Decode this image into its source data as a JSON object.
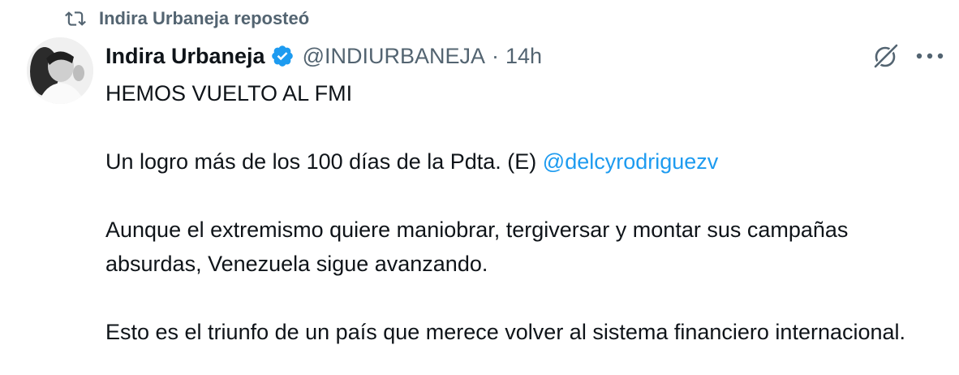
{
  "repost": {
    "icon": "repost-icon",
    "text": "Indira Urbaneja reposteó"
  },
  "author": {
    "name": "Indira Urbaneja",
    "handle": "@INDIURBANEJA",
    "separator": "·",
    "time": "14h",
    "verified_color": "#1d9bf0"
  },
  "actions": {
    "grok_icon": "grok-icon",
    "more_icon": "more-icon"
  },
  "tweet": {
    "line1": "HEMOS VUELTO AL FMI",
    "line2_text": "Un logro más de los 100 días de la Pdta. (E) ",
    "line2_mention": "@delcyrodriguezv",
    "line3": "Aunque el extremismo quiere maniobrar, tergiversar y montar sus campañas absurdas, Venezuela sigue avanzando.",
    "line4": "Esto es el triunfo de un país que merece volver al sistema financiero internacional."
  },
  "colors": {
    "text": "#0f1419",
    "secondary": "#536471",
    "link": "#1d9bf0"
  }
}
